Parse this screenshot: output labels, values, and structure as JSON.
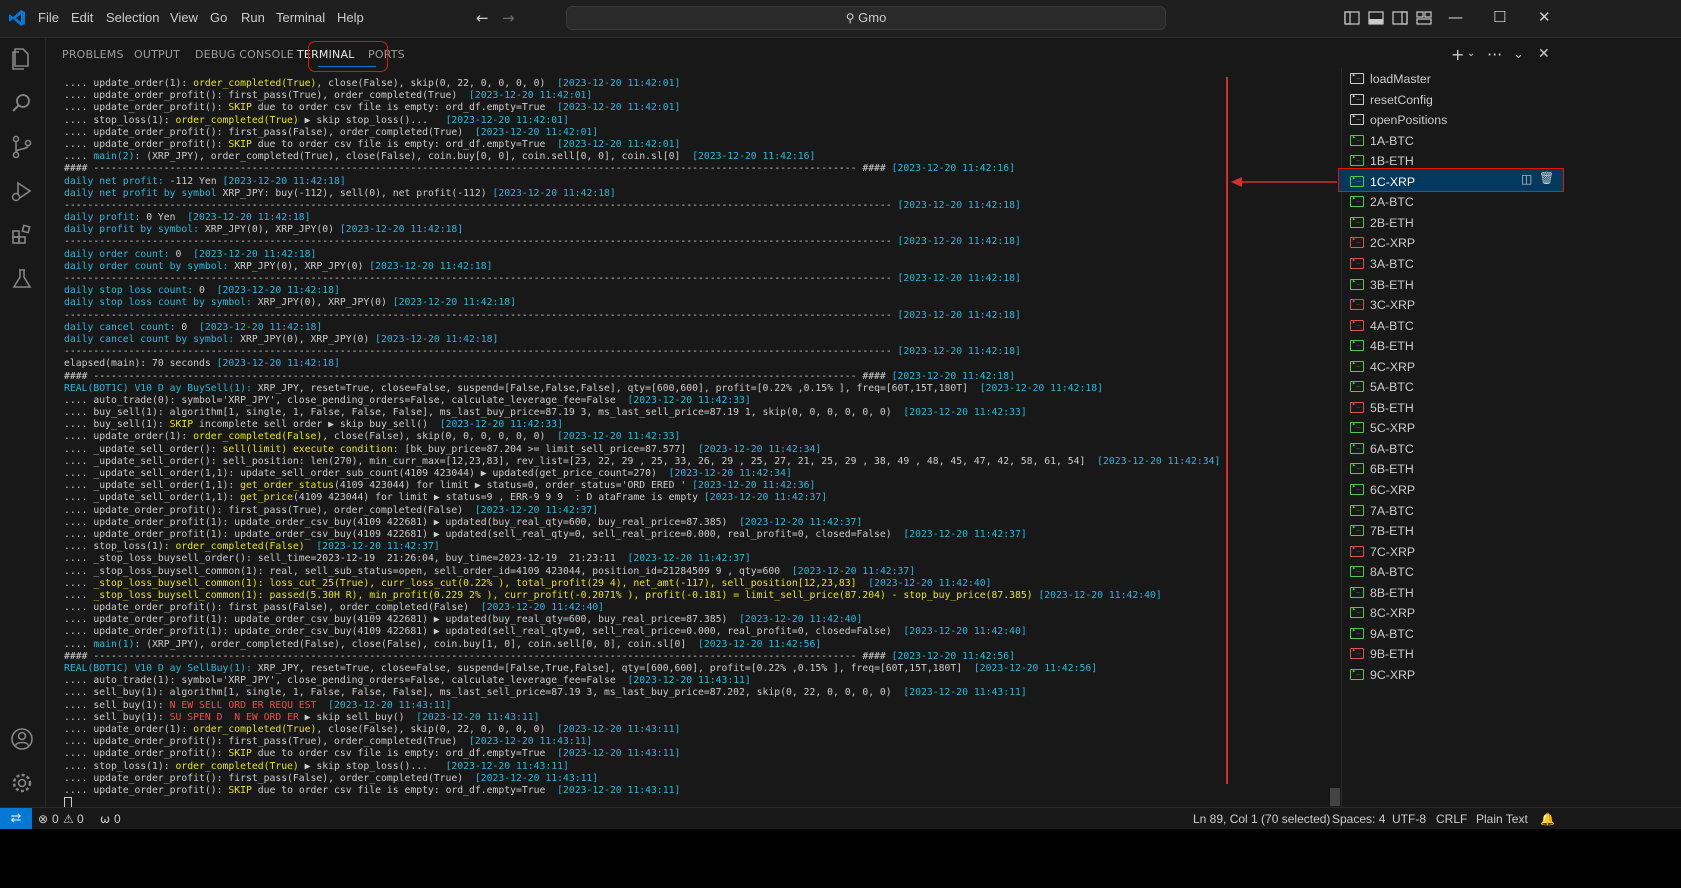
{
  "titlebar": {
    "menu": [
      "File",
      "Edit",
      "Selection",
      "View",
      "Go",
      "Run",
      "Terminal",
      "Help"
    ],
    "search_text": "Gmo",
    "back_icon": "arrow-left-icon",
    "forward_icon": "arrow-right-icon"
  },
  "panel": {
    "tabs": [
      "PROBLEMS",
      "OUTPUT",
      "DEBUG CONSOLE",
      "TERMINAL",
      "PORTS"
    ],
    "active_tab": "TERMINAL"
  },
  "colors": {
    "accent": "#0078d4",
    "annotation": "#e51400",
    "term_yellow": "#e5e510",
    "term_red": "#f14c4c",
    "term_timestamp": "#29b8db",
    "icon_green": "#4ec94e",
    "icon_red": "#d9534f"
  },
  "terminal_lines": [
    [
      [
        "n",
        ".... update_order(1): "
      ],
      [
        "y",
        "order_completed(True)"
      ],
      [
        "n",
        ", close(False), skip(0, 22, 0, 0, 0, 0)  "
      ],
      [
        "t",
        "[2023-12-20 11:42:01]"
      ]
    ],
    [
      [
        "n",
        ".... update_order_profit(): first_pass(True), order_completed(True)  "
      ],
      [
        "t",
        "[2023-12-20 11:42:01]"
      ]
    ],
    [
      [
        "n",
        ".... update_order_profit(): "
      ],
      [
        "y",
        "SKIP"
      ],
      [
        "n",
        " due to order csv file is empty: ord_df.empty=True  "
      ],
      [
        "t",
        "[2023-12-20 11:42:01]"
      ]
    ],
    [
      [
        "n",
        ".... stop_loss(1): "
      ],
      [
        "y",
        "order_completed(True)"
      ],
      [
        "n",
        " ▶ skip stop_loss()...   "
      ],
      [
        "t",
        "[2023-12-20 11:42:01]"
      ]
    ],
    [
      [
        "n",
        ".... update_order_profit(): first_pass(False), order_completed(True)  "
      ],
      [
        "t",
        "[2023-12-20 11:42:01]"
      ]
    ],
    [
      [
        "n",
        ".... update_order_profit(): "
      ],
      [
        "y",
        "SKIP"
      ],
      [
        "n",
        " due to order csv file is empty: ord_df.empty=True  "
      ],
      [
        "t",
        "[2023-12-20 11:42:01]"
      ]
    ],
    [
      [
        "n",
        ".... "
      ],
      [
        "t",
        "main(2)"
      ],
      [
        "n",
        ": (XRP_JPY), order_completed(True), close(False), coin.buy[0, 0], coin.sell[0, 0], coin.sl[0]  "
      ],
      [
        "t",
        "[2023-12-20 11:42:16]"
      ]
    ],
    [
      [
        "n",
        "#### ---------------------------------------------------------------------------------------------------------------------------------- #### "
      ],
      [
        "t",
        "[2023-12-20 11:42:16]"
      ]
    ],
    [
      [
        "t",
        "daily net profit: "
      ],
      [
        "n",
        "-112 Yen "
      ],
      [
        "t",
        "[2023-12-20 11:42:18]"
      ]
    ],
    [
      [
        "t",
        "daily net profit by symbol "
      ],
      [
        "n",
        "XRP_JPY: buy(-112), sell(0), net profit(-112) "
      ],
      [
        "t",
        "[2023-12-20 11:42:18]"
      ]
    ],
    [
      [
        "n",
        "--------------------------------------------------------------------------------------------------------------------------------------------- "
      ],
      [
        "t",
        "[2023-12-20 11:42:18]"
      ]
    ],
    [
      [
        "t",
        "daily profit: "
      ],
      [
        "n",
        "0 Yen  "
      ],
      [
        "t",
        "[2023-12-20 11:42:18]"
      ]
    ],
    [
      [
        "t",
        "daily profit by symbol: "
      ],
      [
        "n",
        "XRP_JPY(0), XRP_JPY(0) "
      ],
      [
        "t",
        "[2023-12-20 11:42:18]"
      ]
    ],
    [
      [
        "n",
        "--------------------------------------------------------------------------------------------------------------------------------------------- "
      ],
      [
        "t",
        "[2023-12-20 11:42:18]"
      ]
    ],
    [
      [
        "t",
        "daily order count: "
      ],
      [
        "n",
        "0  "
      ],
      [
        "t",
        "[2023-12-20 11:42:18]"
      ]
    ],
    [
      [
        "t",
        "daily order count by symbol: "
      ],
      [
        "n",
        "XRP_JPY(0), XRP_JPY(0) "
      ],
      [
        "t",
        "[2023-12-20 11:42:18]"
      ]
    ],
    [
      [
        "n",
        "--------------------------------------------------------------------------------------------------------------------------------------------- "
      ],
      [
        "t",
        "[2023-12-20 11:42:18]"
      ]
    ],
    [
      [
        "t",
        "daily stop loss count: "
      ],
      [
        "n",
        "0  "
      ],
      [
        "t",
        "[2023-12-20 11:42:18]"
      ]
    ],
    [
      [
        "t",
        "daily stop loss count by symbol: "
      ],
      [
        "n",
        "XRP_JPY(0), XRP_JPY(0) "
      ],
      [
        "t",
        "[2023-12-20 11:42:18]"
      ]
    ],
    [
      [
        "n",
        "--------------------------------------------------------------------------------------------------------------------------------------------- "
      ],
      [
        "t",
        "[2023-12-20 11:42:18]"
      ]
    ],
    [
      [
        "t",
        "daily cancel count: "
      ],
      [
        "n",
        "0  "
      ],
      [
        "t",
        "[2023-12-20 11:42:18]"
      ]
    ],
    [
      [
        "t",
        "daily cancel count by symbol: "
      ],
      [
        "n",
        "XRP_JPY(0), XRP_JPY(0) "
      ],
      [
        "t",
        "[2023-12-20 11:42:18]"
      ]
    ],
    [
      [
        "n",
        "--------------------------------------------------------------------------------------------------------------------------------------------- "
      ],
      [
        "t",
        "[2023-12-20 11:42:18]"
      ]
    ],
    [
      [
        "n",
        "elapsed(main): 70 seconds "
      ],
      [
        "t",
        "[2023-12-20 11:42:18]"
      ]
    ],
    [
      [
        "n",
        "#### ---------------------------------------------------------------------------------------------------------------------------------- #### "
      ],
      [
        "t",
        "[2023-12-20 11:42:18]"
      ]
    ],
    [
      [
        "t",
        "REAL(BOT1C) V10 D ay BuySell(1): "
      ],
      [
        "n",
        "XRP_JPY, reset=True, close=False, suspend=[False,False,False], qty=[600,600], profit=[0.22% ,0.15% ], freq=[60T,15T,180T]  "
      ],
      [
        "t",
        "[2023-12-20 11:42:18]"
      ]
    ],
    [
      [
        "n",
        ".... auto_trade(0): symbol='XRP_JPY', close_pending_orders=False, calculate_leverage_fee=False  "
      ],
      [
        "t",
        "[2023-12-20 11:42:33]"
      ]
    ],
    [
      [
        "n",
        ".... buy_sell(1): algorithm[1, single, 1, False, False, False], ms_last_buy_price=87.19 3, ms_last_sell_price=87.19 1, skip(0, 0, 0, 0, 0, 0)  "
      ],
      [
        "t",
        "[2023-12-20 11:42:33]"
      ]
    ],
    [
      [
        "n",
        ".... buy_sell(1): "
      ],
      [
        "y",
        "SKIP"
      ],
      [
        "n",
        " incomplete sell order ▶ skip buy_sell()  "
      ],
      [
        "t",
        "[2023-12-20 11:42:33]"
      ]
    ],
    [
      [
        "n",
        ".... update_order(1): "
      ],
      [
        "y",
        "order_completed(False)"
      ],
      [
        "n",
        ", close(False), skip(0, 0, 0, 0, 0, 0)  "
      ],
      [
        "t",
        "[2023-12-20 11:42:33]"
      ]
    ],
    [
      [
        "n",
        ".... _update_sell_order(): "
      ],
      [
        "y",
        "sell(limit) execute condition"
      ],
      [
        "n",
        ": [bk_buy_price=87.204 >= limit_sell_price=87.577]  "
      ],
      [
        "t",
        "[2023-12-20 11:42:34]"
      ]
    ],
    [
      [
        "n",
        ".... _update_sell_order(): sell_position: len(270), min_curr_max=[12,23,83], rev_list=[23, 22, 29 , 25, 33, 26, 29 , 25, 27, 21, 25, 29 , 38, 49 , 48, 45, 47, 42, 58, 61, 54]  "
      ],
      [
        "t",
        "[2023-12-20 11:42:34]"
      ]
    ],
    [
      [
        "n",
        ".... _update_sell_order(1,1): update_sell_order_sub_count(4109 423044) ▶ updated(get_price_count=270)  "
      ],
      [
        "t",
        "[2023-12-20 11:42:34]"
      ]
    ],
    [
      [
        "n",
        ".... _update_sell_order(1,1): "
      ],
      [
        "y",
        "get_order_status"
      ],
      [
        "n",
        "(4109 423044) for limit ▶ status=0, order_status='ORD ERED ' "
      ],
      [
        "t",
        "[2023-12-20 11:42:36]"
      ]
    ],
    [
      [
        "n",
        ".... _update_sell_order(1,1): "
      ],
      [
        "y",
        "get_price"
      ],
      [
        "n",
        "(4109 423044) for limit ▶ status=9 , ERR-9 9 9  : D ataFrame is empty "
      ],
      [
        "t",
        "[2023-12-20 11:42:37]"
      ]
    ],
    [
      [
        "n",
        ".... update_order_profit(): first_pass(True), order_completed(False)  "
      ],
      [
        "t",
        "[2023-12-20 11:42:37]"
      ]
    ],
    [
      [
        "n",
        ".... update_order_profit(1): update_order_csv_buy(4109 422681) ▶ updated(buy_real_qty=600, buy_real_price=87.385)  "
      ],
      [
        "t",
        "[2023-12-20 11:42:37]"
      ]
    ],
    [
      [
        "n",
        ".... update_order_profit(1): update_order_csv_buy(4109 422681) ▶ updated(sell_real_qty=0, sell_real_price=0.000, real_profit=0, closed=False)  "
      ],
      [
        "t",
        "[2023-12-20 11:42:37]"
      ]
    ],
    [
      [
        "n",
        ".... stop_loss(1): "
      ],
      [
        "y",
        "order_completed(False)"
      ],
      [
        "n",
        "  "
      ],
      [
        "t",
        "[2023-12-20 11:42:37]"
      ]
    ],
    [
      [
        "n",
        ".... _stop_loss_buysell_order(): sell_time=2023-12-19  21:26:04, buy_time=2023-12-19  21:23:11  "
      ],
      [
        "t",
        "[2023-12-20 11:42:37]"
      ]
    ],
    [
      [
        "n",
        ".... _stop_loss_buysell_common(1): real, sell_sub_status=open, sell_order_id=4109 423044, position_id=21284509 9 , qty=600  "
      ],
      [
        "t",
        "[2023-12-20 11:42:37]"
      ]
    ],
    [
      [
        "n",
        ".... "
      ],
      [
        "y",
        "_stop_loss_buysell_common(1): loss_cut_25(True), curr_loss_cut(0.22% ), total_profit(29 4), net_amt(-117), sell_position[12,23,83]"
      ],
      [
        "n",
        "  "
      ],
      [
        "t",
        "[2023-12-20 11:42:40]"
      ]
    ],
    [
      [
        "n",
        ".... "
      ],
      [
        "y",
        "_stop_loss_buysell_common(1): passed(5.30H R), min_profit(0.229 2% ), curr_profit(-0.2071% ), profit(-0.181) = limit_sell_price(87.204) - stop_buy_price(87.385)"
      ],
      [
        "n",
        " "
      ],
      [
        "t",
        "[2023-12-20 11:42:40]"
      ]
    ],
    [
      [
        "n",
        ".... update_order_profit(): first_pass(False), order_completed(False)  "
      ],
      [
        "t",
        "[2023-12-20 11:42:40]"
      ]
    ],
    [
      [
        "n",
        ".... update_order_profit(1): update_order_csv_buy(4109 422681) ▶ updated(buy_real_qty=600, buy_real_price=87.385)  "
      ],
      [
        "t",
        "[2023-12-20 11:42:40]"
      ]
    ],
    [
      [
        "n",
        ".... update_order_profit(1): update_order_csv_buy(4109 422681) ▶ updated(sell_real_qty=0, sell_real_price=0.000, real_profit=0, closed=False)  "
      ],
      [
        "t",
        "[2023-12-20 11:42:40]"
      ]
    ],
    [
      [
        "n",
        ".... "
      ],
      [
        "t",
        "main(1)"
      ],
      [
        "n",
        ": (XRP_JPY), order_completed(False), close(False), coin.buy[1, 0], coin.sell[0, 0], coin.sl[0]  "
      ],
      [
        "t",
        "[2023-12-20 11:42:56]"
      ]
    ],
    [
      [
        "n",
        "#### ---------------------------------------------------------------------------------------------------------------------------------- #### "
      ],
      [
        "t",
        "[2023-12-20 11:42:56]"
      ]
    ],
    [
      [
        "t",
        "REAL(BOT1C) V10 D ay SellBuy(1): "
      ],
      [
        "n",
        "XRP_JPY, reset=True, close=False, suspend=[False,True,False], qty=[600,600], profit=[0.22% ,0.15% ], freq=[60T,15T,180T]  "
      ],
      [
        "t",
        "[2023-12-20 11:42:56]"
      ]
    ],
    [
      [
        "n",
        ".... auto_trade(1): symbol='XRP_JPY', close_pending_orders=False, calculate_leverage_fee=False  "
      ],
      [
        "t",
        "[2023-12-20 11:43:11]"
      ]
    ],
    [
      [
        "n",
        ".... sell_buy(1): algorithm[1, single, 1, False, False, False], ms_last_sell_price=87.19 3, ms_last_buy_price=87.202, skip(0, 22, 0, 0, 0, 0)  "
      ],
      [
        "t",
        "[2023-12-20 11:43:11]"
      ]
    ],
    [
      [
        "n",
        ".... sell_buy(1): "
      ],
      [
        "r",
        "N EW SELL ORD ER REQU EST"
      ],
      [
        "n",
        "  "
      ],
      [
        "t",
        "[2023-12-20 11:43:11]"
      ]
    ],
    [
      [
        "n",
        ".... sell_buy(1): "
      ],
      [
        "r",
        "SU SPEN D  N EW ORD ER"
      ],
      [
        "n",
        " ▶ skip sell_buy()  "
      ],
      [
        "t",
        "[2023-12-20 11:43:11]"
      ]
    ],
    [
      [
        "n",
        ".... update_order(1): "
      ],
      [
        "y",
        "order_completed(True)"
      ],
      [
        "n",
        ", close(False), skip(0, 22, 0, 0, 0, 0)  "
      ],
      [
        "t",
        "[2023-12-20 11:43:11]"
      ]
    ],
    [
      [
        "n",
        ".... update_order_profit(): first_pass(True), order_completed(True)  "
      ],
      [
        "t",
        "[2023-12-20 11:43:11]"
      ]
    ],
    [
      [
        "n",
        ".... update_order_profit(): "
      ],
      [
        "y",
        "SKIP"
      ],
      [
        "n",
        " due to order csv file is empty: ord_df.empty=True  "
      ],
      [
        "t",
        "[2023-12-20 11:43:11]"
      ]
    ],
    [
      [
        "n",
        ".... stop_loss(1): "
      ],
      [
        "y",
        "order_completed(True)"
      ],
      [
        "n",
        " ▶ skip stop_loss()...   "
      ],
      [
        "t",
        "[2023-12-20 11:43:11]"
      ]
    ],
    [
      [
        "n",
        ".... update_order_profit(): first_pass(False), order_completed(True)  "
      ],
      [
        "t",
        "[2023-12-20 11:43:11]"
      ]
    ],
    [
      [
        "n",
        ".... update_order_profit(): "
      ],
      [
        "y",
        "SKIP"
      ],
      [
        "n",
        " due to order csv file is empty: ord_df.empty=True  "
      ],
      [
        "t",
        "[2023-12-20 11:43:11]"
      ]
    ]
  ],
  "terminal_list": [
    {
      "label": "loadMaster",
      "icon": "terminal-icon",
      "color": "#cccccc"
    },
    {
      "label": "resetConfig",
      "icon": "terminal-icon",
      "color": "#cccccc"
    },
    {
      "label": "openPositions",
      "icon": "terminal-icon",
      "color": "#cccccc"
    },
    {
      "label": "1A-BTC",
      "icon": "terminal-icon",
      "color": "#4ec94e"
    },
    {
      "label": "1B-ETH",
      "icon": "terminal-icon",
      "color": "#4ec94e"
    },
    {
      "label": "1C-XRP",
      "icon": "terminal-icon",
      "color": "#4ec94e",
      "selected": true
    },
    {
      "label": "2A-BTC",
      "icon": "terminal-icon",
      "color": "#4ec94e"
    },
    {
      "label": "2B-ETH",
      "icon": "terminal-icon",
      "color": "#4ec94e"
    },
    {
      "label": "2C-XRP",
      "icon": "terminal-icon",
      "color": "#d9534f"
    },
    {
      "label": "3A-BTC",
      "icon": "terminal-icon",
      "color": "#d9534f"
    },
    {
      "label": "3B-ETH",
      "icon": "terminal-icon",
      "color": "#4ec94e"
    },
    {
      "label": "3C-XRP",
      "icon": "terminal-icon",
      "color": "#d9534f"
    },
    {
      "label": "4A-BTC",
      "icon": "terminal-icon",
      "color": "#d9534f"
    },
    {
      "label": "4B-ETH",
      "icon": "terminal-icon",
      "color": "#4ec94e"
    },
    {
      "label": "4C-XRP",
      "icon": "terminal-icon",
      "color": "#4ec94e"
    },
    {
      "label": "5A-BTC",
      "icon": "terminal-icon",
      "color": "#4ec94e"
    },
    {
      "label": "5B-ETH",
      "icon": "terminal-icon",
      "color": "#d9534f"
    },
    {
      "label": "5C-XRP",
      "icon": "terminal-icon",
      "color": "#4ec94e"
    },
    {
      "label": "6A-BTC",
      "icon": "terminal-icon",
      "color": "#4ec94e"
    },
    {
      "label": "6B-ETH",
      "icon": "terminal-icon",
      "color": "#4ec94e"
    },
    {
      "label": "6C-XRP",
      "icon": "terminal-icon",
      "color": "#4ec94e"
    },
    {
      "label": "7A-BTC",
      "icon": "terminal-icon",
      "color": "#4ec94e"
    },
    {
      "label": "7B-ETH",
      "icon": "terminal-icon",
      "color": "#4ec94e"
    },
    {
      "label": "7C-XRP",
      "icon": "terminal-icon",
      "color": "#d9534f"
    },
    {
      "label": "8A-BTC",
      "icon": "terminal-icon",
      "color": "#4ec94e"
    },
    {
      "label": "8B-ETH",
      "icon": "terminal-icon",
      "color": "#4ec94e"
    },
    {
      "label": "8C-XRP",
      "icon": "terminal-icon",
      "color": "#4ec94e"
    },
    {
      "label": "9A-BTC",
      "icon": "terminal-icon",
      "color": "#4ec94e"
    },
    {
      "label": "9B-ETH",
      "icon": "terminal-icon",
      "color": "#d9534f"
    },
    {
      "label": "9C-XRP",
      "icon": "terminal-icon",
      "color": "#4ec94e"
    }
  ],
  "statusbar": {
    "errors": "0",
    "warnings": "0",
    "ports": "0",
    "cursor_position": "Ln 89, Col 1 (70 selected)",
    "spaces": "Spaces: 4",
    "encoding": "UTF-8",
    "eol": "CRLF",
    "language": "Plain Text"
  }
}
